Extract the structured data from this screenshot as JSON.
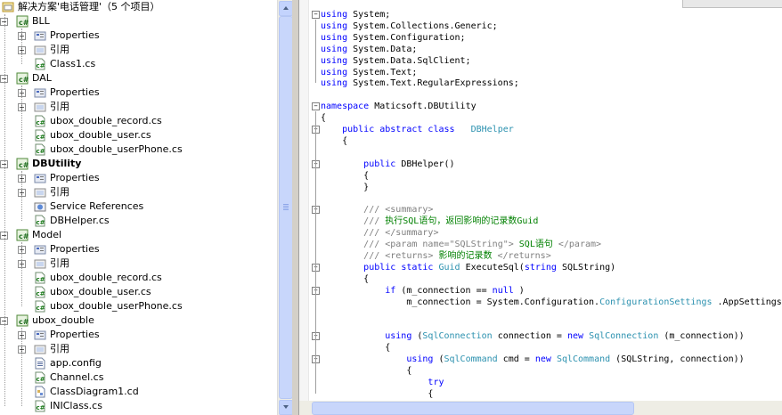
{
  "solution": {
    "title": "解决方案'电话管理'（5 个项目）",
    "projects": [
      {
        "name": "BLL",
        "bold": false,
        "items": [
          {
            "label": "Properties",
            "icon": "properties-icon"
          },
          {
            "label": "引用",
            "icon": "references-icon"
          },
          {
            "label": "Class1.cs",
            "icon": "csharp-file-icon"
          }
        ]
      },
      {
        "name": "DAL",
        "bold": false,
        "items": [
          {
            "label": "Properties",
            "icon": "properties-icon"
          },
          {
            "label": "引用",
            "icon": "references-icon"
          },
          {
            "label": "ubox_double_record.cs",
            "icon": "csharp-file-icon"
          },
          {
            "label": "ubox_double_user.cs",
            "icon": "csharp-file-icon"
          },
          {
            "label": "ubox_double_userPhone.cs",
            "icon": "csharp-file-icon"
          }
        ]
      },
      {
        "name": "DBUtility",
        "bold": true,
        "items": [
          {
            "label": "Properties",
            "icon": "properties-icon"
          },
          {
            "label": "引用",
            "icon": "references-icon"
          },
          {
            "label": "Service References",
            "icon": "service-references-icon"
          },
          {
            "label": "DBHelper.cs",
            "icon": "csharp-file-icon"
          }
        ]
      },
      {
        "name": "Model",
        "bold": false,
        "items": [
          {
            "label": "Properties",
            "icon": "properties-icon"
          },
          {
            "label": "引用",
            "icon": "references-icon"
          },
          {
            "label": "ubox_double_record.cs",
            "icon": "csharp-file-icon"
          },
          {
            "label": "ubox_double_user.cs",
            "icon": "csharp-file-icon"
          },
          {
            "label": "ubox_double_userPhone.cs",
            "icon": "csharp-file-icon"
          }
        ]
      },
      {
        "name": "ubox_double",
        "bold": false,
        "items": [
          {
            "label": "Properties",
            "icon": "properties-icon"
          },
          {
            "label": "引用",
            "icon": "references-icon"
          },
          {
            "label": "app.config",
            "icon": "config-file-icon"
          },
          {
            "label": "Channel.cs",
            "icon": "csharp-file-icon"
          },
          {
            "label": "ClassDiagram1.cd",
            "icon": "class-diagram-icon"
          },
          {
            "label": "INIClass.cs",
            "icon": "csharp-file-icon"
          }
        ]
      }
    ]
  },
  "editor": {
    "lines": [
      {
        "y": 0,
        "parts": [
          [
            "kw",
            "using"
          ],
          [
            "",
            "System;"
          ]
        ]
      },
      {
        "y": 1,
        "parts": [
          [
            "kw",
            "using"
          ],
          [
            "",
            "System.Collections.Generic;"
          ]
        ]
      },
      {
        "y": 2,
        "parts": [
          [
            "kw",
            "using"
          ],
          [
            "",
            "System.Configuration;"
          ]
        ]
      },
      {
        "y": 3,
        "parts": [
          [
            "kw",
            "using"
          ],
          [
            "",
            "System.Data;"
          ]
        ]
      },
      {
        "y": 4,
        "parts": [
          [
            "kw",
            "using"
          ],
          [
            "",
            "System.Data.SqlClient;"
          ]
        ]
      },
      {
        "y": 5,
        "parts": [
          [
            "kw",
            "using"
          ],
          [
            "",
            "System.Text;"
          ]
        ]
      },
      {
        "y": 6,
        "parts": [
          [
            "kw",
            "using"
          ],
          [
            "",
            "System.Text.RegularExpressions;"
          ]
        ]
      },
      {
        "y": 8,
        "parts": [
          [
            "kw",
            "namespace"
          ],
          [
            "",
            "Maticsoft.DBUtility"
          ]
        ]
      },
      {
        "y": 9,
        "parts": [
          [
            "",
            "{"
          ]
        ]
      },
      {
        "y": 10,
        "parts": [
          [
            "",
            "    "
          ],
          [
            "kw",
            "public abstract class"
          ],
          [
            "",
            "  "
          ],
          [
            "ty",
            "DBHelper"
          ]
        ]
      },
      {
        "y": 11,
        "parts": [
          [
            "",
            "    {"
          ]
        ]
      },
      {
        "y": 13,
        "parts": [
          [
            "",
            "        "
          ],
          [
            "kw",
            "public"
          ],
          [
            "",
            "DBHelper()"
          ]
        ]
      },
      {
        "y": 14,
        "parts": [
          [
            "",
            "        {"
          ]
        ]
      },
      {
        "y": 15,
        "parts": [
          [
            "",
            "        }"
          ]
        ]
      },
      {
        "y": 17,
        "parts": [
          [
            "",
            "        "
          ],
          [
            "xm",
            "///"
          ],
          [
            "cm",
            ""
          ],
          [
            "xm",
            "<summary>"
          ]
        ]
      },
      {
        "y": 18,
        "parts": [
          [
            "",
            "        "
          ],
          [
            "xm",
            "///"
          ],
          [
            "cm",
            "执行SQL语句，返回影响的记录数Guid"
          ]
        ]
      },
      {
        "y": 19,
        "parts": [
          [
            "",
            "        "
          ],
          [
            "xm",
            "///"
          ],
          [
            "cm",
            ""
          ],
          [
            "xm",
            "</summary>"
          ]
        ]
      },
      {
        "y": 20,
        "parts": [
          [
            "",
            "        "
          ],
          [
            "xm",
            "///"
          ],
          [
            "cm",
            ""
          ],
          [
            "xm",
            "<param name=\"SQLString\">"
          ],
          [
            "cm",
            "SQL语句"
          ],
          [
            "xm",
            "</param>"
          ]
        ]
      },
      {
        "y": 21,
        "parts": [
          [
            "",
            "        "
          ],
          [
            "xm",
            "///"
          ],
          [
            "cm",
            ""
          ],
          [
            "xm",
            "<returns>"
          ],
          [
            "cm",
            "影响的记录数"
          ],
          [
            "xm",
            "</returns>"
          ]
        ]
      },
      {
        "y": 22,
        "parts": [
          [
            "",
            "        "
          ],
          [
            "kw",
            "public static"
          ],
          [
            "ty",
            "Guid"
          ],
          [
            "",
            "ExecuteSql("
          ],
          [
            "kw",
            "string"
          ],
          [
            "",
            "SQLString)"
          ]
        ]
      },
      {
        "y": 23,
        "parts": [
          [
            "",
            "        {"
          ]
        ]
      },
      {
        "y": 24,
        "parts": [
          [
            "",
            "            "
          ],
          [
            "kw",
            "if"
          ],
          [
            "",
            "(m_connection == "
          ],
          [
            "kw",
            "null"
          ],
          [
            "",
            ")"
          ]
        ]
      },
      {
        "y": 25,
        "parts": [
          [
            "",
            "                m_connection = System.Configuration."
          ],
          [
            "ty",
            "ConfigurationSettings"
          ],
          [
            "",
            ".AppSettings[\""
          ]
        ]
      },
      {
        "y": 28,
        "parts": [
          [
            "",
            "            "
          ],
          [
            "kw",
            "using"
          ],
          [
            "",
            "("
          ],
          [
            "ty",
            "SqlConnection"
          ],
          [
            "",
            "connection = "
          ],
          [
            "kw",
            "new"
          ],
          [
            "ty",
            "SqlConnection"
          ],
          [
            "",
            "(m_connection))"
          ]
        ]
      },
      {
        "y": 29,
        "parts": [
          [
            "",
            "            {"
          ]
        ]
      },
      {
        "y": 30,
        "parts": [
          [
            "",
            "                "
          ],
          [
            "kw",
            "using"
          ],
          [
            "",
            "("
          ],
          [
            "ty",
            "SqlCommand"
          ],
          [
            "",
            "cmd = "
          ],
          [
            "kw",
            "new"
          ],
          [
            "ty",
            "SqlCommand"
          ],
          [
            "",
            "(SQLString, connection))"
          ]
        ]
      },
      {
        "y": 31,
        "parts": [
          [
            "",
            "                {"
          ]
        ]
      },
      {
        "y": 32,
        "parts": [
          [
            "",
            "                    "
          ],
          [
            "kw",
            "try"
          ]
        ]
      },
      {
        "y": 33,
        "parts": [
          [
            "",
            "                    {"
          ]
        ]
      }
    ]
  }
}
